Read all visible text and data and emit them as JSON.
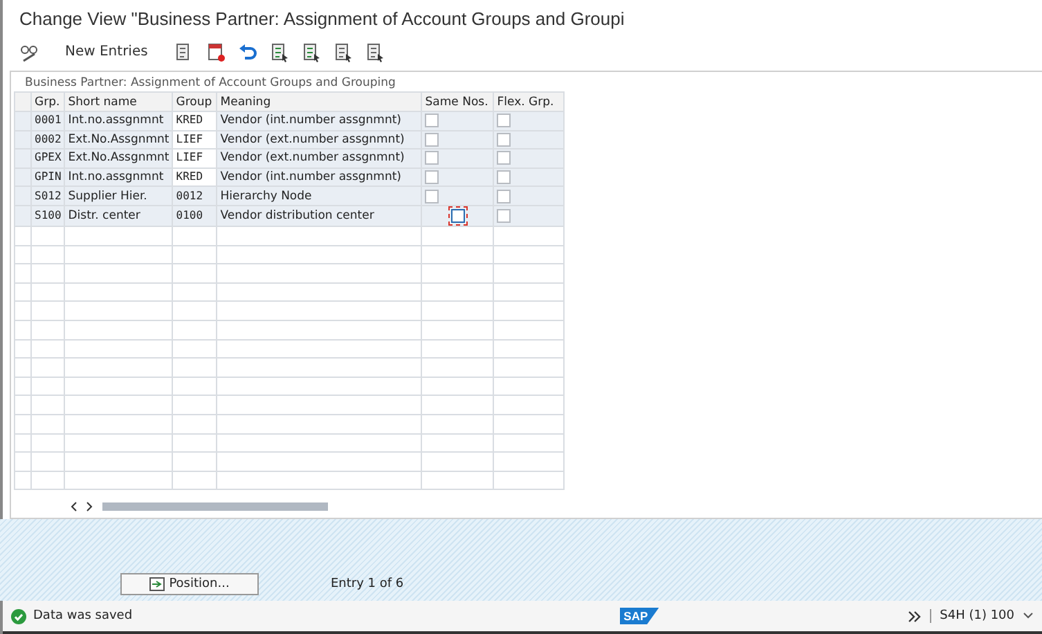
{
  "window": {
    "title": "Change View \"Business Partner: Assignment of Account Groups and Groupi"
  },
  "toolbar": {
    "new_entries": "New Entries"
  },
  "table": {
    "title": "Business Partner: Assignment of Account Groups and Grouping",
    "columns": [
      "Grp.",
      "Short name",
      "Group",
      "Meaning",
      "Same Nos.",
      "Flex. Grp."
    ],
    "rows": [
      {
        "grp": "0001",
        "short_name": "Int.no.assgnmnt",
        "group": "KRED",
        "group_editable": true,
        "meaning": "Vendor (int.number assgnmnt)",
        "same_nos": false,
        "same_nos_focused": false,
        "flex_grp": false
      },
      {
        "grp": "0002",
        "short_name": "Ext.No.Assgnmnt",
        "group": "LIEF",
        "group_editable": true,
        "meaning": "Vendor (ext.number assgnmnt)",
        "same_nos": false,
        "same_nos_focused": false,
        "flex_grp": false
      },
      {
        "grp": "GPEX",
        "short_name": "Ext.No.Assgnmnt",
        "group": "LIEF",
        "group_editable": true,
        "meaning": "Vendor (ext.number assgnmnt)",
        "same_nos": false,
        "same_nos_focused": false,
        "flex_grp": false
      },
      {
        "grp": "GPIN",
        "short_name": "Int.no.assgnmnt",
        "group": "KRED",
        "group_editable": true,
        "meaning": "Vendor (int.number assgnmnt)",
        "same_nos": false,
        "same_nos_focused": false,
        "flex_grp": false
      },
      {
        "grp": "S012",
        "short_name": "Supplier Hier.",
        "group": "0012",
        "group_editable": false,
        "meaning": "Hierarchy Node",
        "same_nos": false,
        "same_nos_focused": false,
        "flex_grp": false
      },
      {
        "grp": "S100",
        "short_name": "Distr. center",
        "group": "0100",
        "group_editable": false,
        "meaning": "Vendor distribution center",
        "same_nos": false,
        "same_nos_focused": true,
        "flex_grp": false
      }
    ]
  },
  "footer": {
    "position_button": "Position...",
    "entry_info": "Entry 1 of 6"
  },
  "status_bar": {
    "message": "Data was saved",
    "logo": "SAP",
    "system": "S4H (1) 100"
  }
}
